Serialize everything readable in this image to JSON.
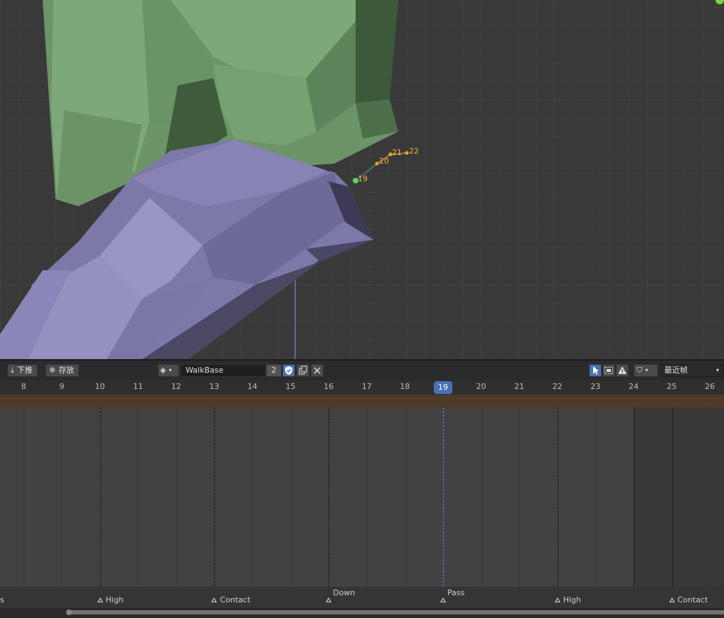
{
  "header": {
    "push_down_label": "下推",
    "stash_label": "存放",
    "action_name": "WalkBase",
    "action_users": "2",
    "snap_mode": "最近帧"
  },
  "viewport": {
    "motion_path_labels": [
      "19",
      "20",
      "21",
      "22"
    ]
  },
  "timeline": {
    "frame_labels": [
      "8",
      "9",
      "10",
      "11",
      "12",
      "13",
      "14",
      "15",
      "16",
      "17",
      "18",
      "19",
      "20",
      "21",
      "22",
      "23",
      "24",
      "25",
      "26"
    ],
    "current_frame": "19",
    "markers": [
      {
        "label": "ass"
      },
      {
        "label": "High"
      },
      {
        "label": "Contact"
      },
      {
        "label": "Down"
      },
      {
        "label": "Pass"
      },
      {
        "label": "High"
      },
      {
        "label": "Contact"
      }
    ]
  },
  "colors": {
    "accent": "#4772b3",
    "motion_path": "#f0a020",
    "green_mesh": "#7ea77c",
    "purple_mesh": "#7f7aab"
  }
}
